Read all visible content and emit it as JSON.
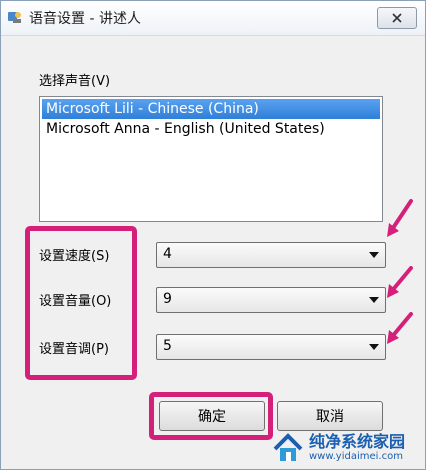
{
  "window": {
    "title": "语音设置 - 讲述人",
    "close_label": "✕"
  },
  "voice_select": {
    "label": "选择声音(V)",
    "items": [
      {
        "label": "Microsoft Lili - Chinese (China)",
        "selected": true
      },
      {
        "label": "Microsoft Anna - English (United States)",
        "selected": false
      }
    ]
  },
  "settings": {
    "speed": {
      "label": "设置速度(S)",
      "value": "4"
    },
    "volume": {
      "label": "设置音量(O)",
      "value": "9"
    },
    "pitch": {
      "label": "设置音调(P)",
      "value": "5"
    }
  },
  "buttons": {
    "ok": "确定",
    "cancel": "取消"
  },
  "watermark": {
    "brand": "纯净系统家园",
    "url": "www.yidaimei.com"
  },
  "colors": {
    "highlight": "#d5207a",
    "selection": "#3a88e0"
  }
}
